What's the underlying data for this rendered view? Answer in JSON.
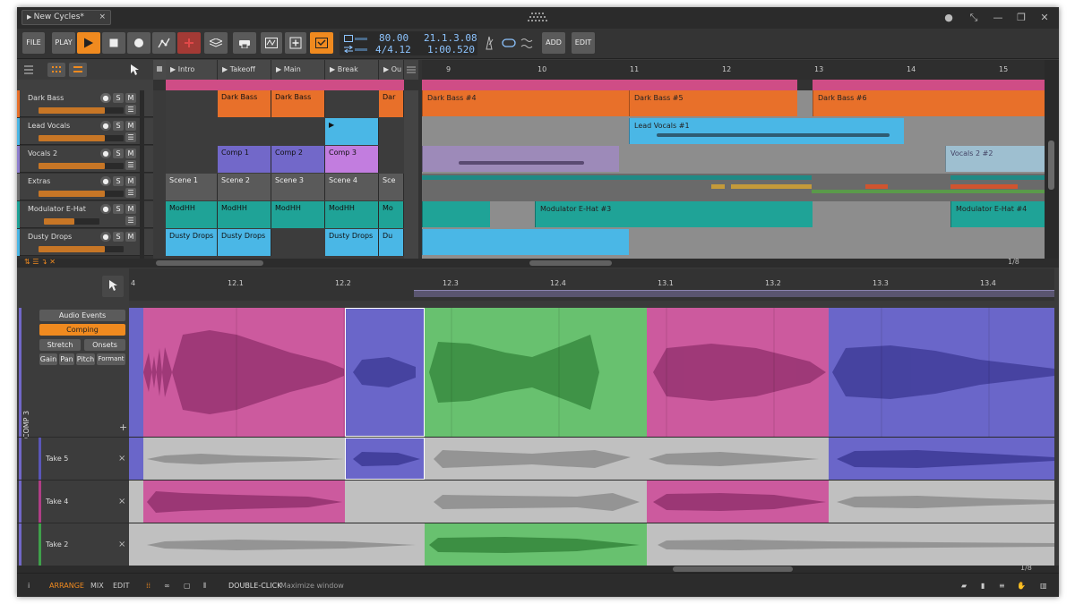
{
  "window": {
    "doc_tab": "New Cycles*",
    "close_glyph": "×",
    "controls": [
      "●",
      "⤡",
      "—",
      "❐",
      "✕"
    ]
  },
  "toolbar": {
    "file": "FILE",
    "play": "PLAY",
    "add": "ADD",
    "edit": "EDIT",
    "tempo": "80.00",
    "signature": "4/4.12",
    "position": "21.1.3.08",
    "time": "1:00.520"
  },
  "clip_launcher": {
    "scenes": [
      "Intro",
      "Takeoff",
      "Main",
      "Break",
      "Ou"
    ],
    "tracks": [
      {
        "name": "Dark Bass",
        "color": "#e8702a",
        "clips": [
          "",
          "Dark Bass",
          "Dark Bass",
          "",
          "Dar"
        ]
      },
      {
        "name": "Lead Vocals",
        "color": "#4ab7e6",
        "clips": [
          "",
          "",
          "",
          "",
          ""
        ]
      },
      {
        "name": "Vocals 2",
        "color": "#8e7ecf",
        "clips": [
          "",
          "Comp 1",
          "Comp 2",
          "Comp 3",
          ""
        ]
      },
      {
        "name": "Extras",
        "color": "#707070",
        "clips": [
          "Scene 1",
          "Scene 2",
          "Scene 3",
          "Scene 4",
          "Sce"
        ]
      },
      {
        "name": "Modulator E-Hat",
        "color": "#1fa397",
        "clips": [
          "ModHH",
          "ModHH",
          "ModHH",
          "ModHH",
          "Mo"
        ]
      },
      {
        "name": "Dusty Drops",
        "color": "#4ab7e6",
        "clips": [
          "Dusty Drops",
          "Dusty Drops",
          "",
          "Dusty Drops",
          "Du"
        ]
      }
    ]
  },
  "arranger": {
    "ruler": [
      "9",
      "10",
      "11",
      "12",
      "13",
      "14",
      "15"
    ],
    "clips": [
      {
        "label": "Dark Bass #4",
        "row": 0
      },
      {
        "label": "Dark Bass #5",
        "row": 0
      },
      {
        "label": "Dark Bass #6",
        "row": 0
      },
      {
        "label": "Lead Vocals #1",
        "row": 1
      },
      {
        "label": "Vocals 2 #2",
        "row": 2
      },
      {
        "label": "Modulator E-Hat #3",
        "row": 4
      },
      {
        "label": "Modulator E-Hat #4",
        "row": 4
      }
    ],
    "grid": "1/8"
  },
  "editor": {
    "ruler": [
      "4",
      "12.1",
      "12.2",
      "12.3",
      "12.4",
      "13.1",
      "13.2",
      "13.3",
      "13.4"
    ],
    "modes": [
      "Audio Events",
      "Comping",
      "Stretch",
      "Onsets",
      "Gain",
      "Pan",
      "Pitch",
      "Formant"
    ],
    "comp_label": "COMP 3",
    "takes": [
      "Take 5",
      "Take 4",
      "Take 2"
    ],
    "grid": "1/8"
  },
  "status": {
    "arrange": "ARRANGE",
    "mix": "MIX",
    "edit": "EDIT",
    "hint_key": "DOUBLE-CLICK",
    "hint_text": "Maximize window"
  },
  "colors": {
    "accent": "#f08a1f",
    "pink": "#cc5a9e",
    "blue": "#6a66c9",
    "green": "#68c16f",
    "grey_take": "#c0c0c0"
  }
}
